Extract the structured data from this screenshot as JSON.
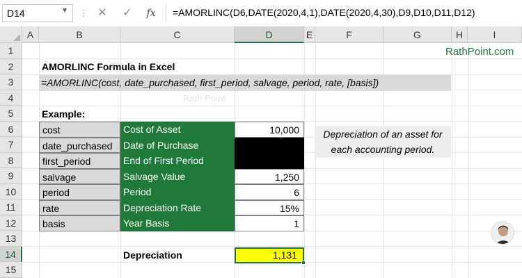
{
  "formula_bar": {
    "name_box": "D14",
    "formula": "=AMORLINC(D6,DATE(2020,4,1),DATE(2020,4,30),D9,D10,D11,D12)",
    "cancel_icon": "close-icon",
    "enter_icon": "check-icon",
    "fx_label": "fx"
  },
  "columns": [
    "A",
    "B",
    "C",
    "D",
    "E",
    "F",
    "G",
    "H",
    "I"
  ],
  "rows": [
    "1",
    "2",
    "3",
    "4",
    "5",
    "6",
    "7",
    "8",
    "9",
    "10",
    "11",
    "12",
    "13",
    "14",
    "15"
  ],
  "selected": {
    "column": "D",
    "row": "14"
  },
  "brand": "RathPoint.com",
  "watermark": "Rath Point",
  "title": "AMORLINC Formula in Excel",
  "syntax": "=AMORLINC(cost, date_purchased, first_period, salvage, period, rate, [basis])",
  "example_label": "Example:",
  "table": [
    {
      "arg": "cost",
      "desc": "Cost of Asset",
      "value": "10,000"
    },
    {
      "arg": "date_purchased",
      "desc": "Date of Purchase",
      "value": ""
    },
    {
      "arg": "first_period",
      "desc": "End of First Period",
      "value": ""
    },
    {
      "arg": "salvage",
      "desc": "Salvage Value",
      "value": "1,250"
    },
    {
      "arg": "period",
      "desc": "Period",
      "value": "6"
    },
    {
      "arg": "rate",
      "desc": "Depreciation Rate",
      "value": "15%"
    },
    {
      "arg": "basis",
      "desc": "Year Basis",
      "value": "1"
    }
  ],
  "description": {
    "line1": "Depreciation of an asset for",
    "line2": "each accounting period."
  },
  "result": {
    "label": "Depreciation",
    "value": "1,131"
  },
  "colors": {
    "green": "#1f7a3a",
    "gray": "#d9d9d9",
    "yellow": "#ffff00",
    "accent": "#217346"
  }
}
